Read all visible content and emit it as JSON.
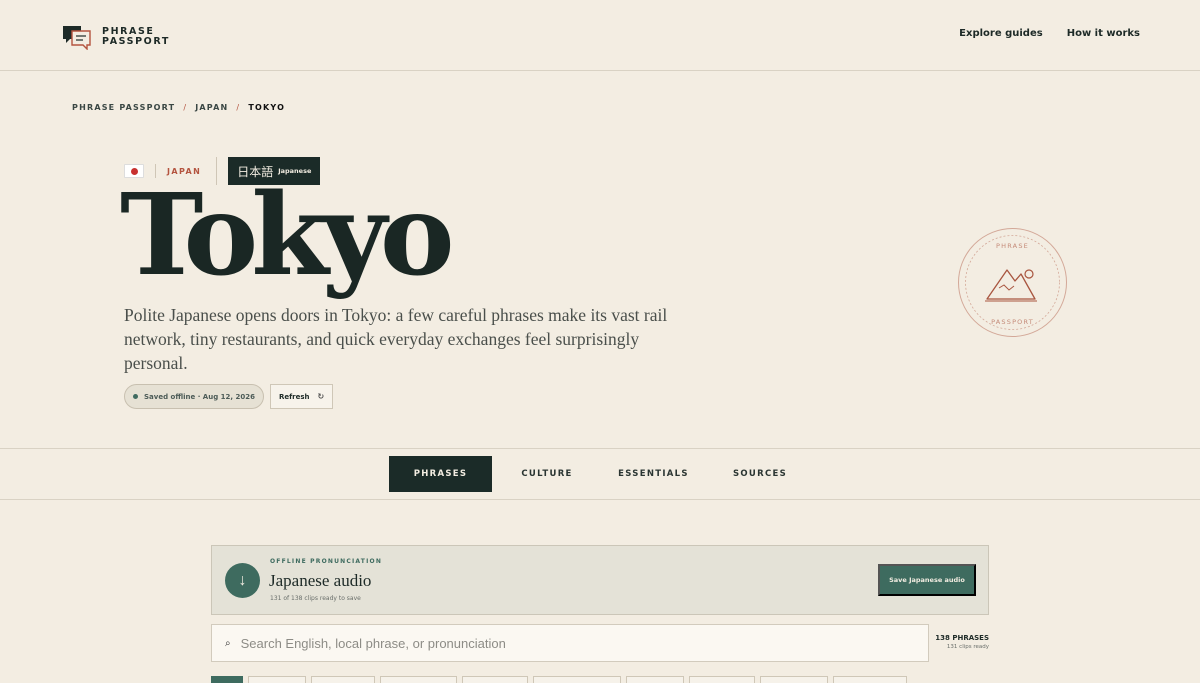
{
  "brand": {
    "line1": "PHRASE",
    "line2": "PASSPORT"
  },
  "nav": {
    "explore": "Explore guides",
    "how": "How it works"
  },
  "breadcrumb": [
    "PHRASE PASSPORT",
    "JAPAN",
    "TOKYO"
  ],
  "breadcrumb_sep": "/",
  "hero": {
    "country": "JAPAN",
    "language_native": "日本語",
    "language_en": "Japanese",
    "city": "Tokyo",
    "intro": "Polite Japanese opens doors in Tokyo: a few careful phrases make its vast rail network, tiny restaurants, and quick everyday exchanges feel surprisingly personal.",
    "saved_status": "Saved offline · Aug 12, 2026",
    "refresh_label": "Refresh",
    "refresh_icon": "↻"
  },
  "stamp": {
    "top": "PHRASE",
    "bottom": "PASSPORT"
  },
  "tabs": [
    "PHRASES",
    "CULTURE",
    "ESSENTIALS",
    "SOURCES"
  ],
  "audio": {
    "kicker": "OFFLINE PRONUNCIATION",
    "title": "Japanese audio",
    "sub": "131 of 138 clips ready to save",
    "button": "Save Japanese audio",
    "icon": "↓"
  },
  "search": {
    "placeholder": "Search English, local phrase, or pronunciation",
    "count": "138 PHRASES",
    "ready": "131 clips ready",
    "icon": "⌕"
  },
  "colors": {
    "background": "#f3ede2",
    "ink": "#1b2b28",
    "accent": "#b4543f",
    "green": "#3e6b5f"
  }
}
